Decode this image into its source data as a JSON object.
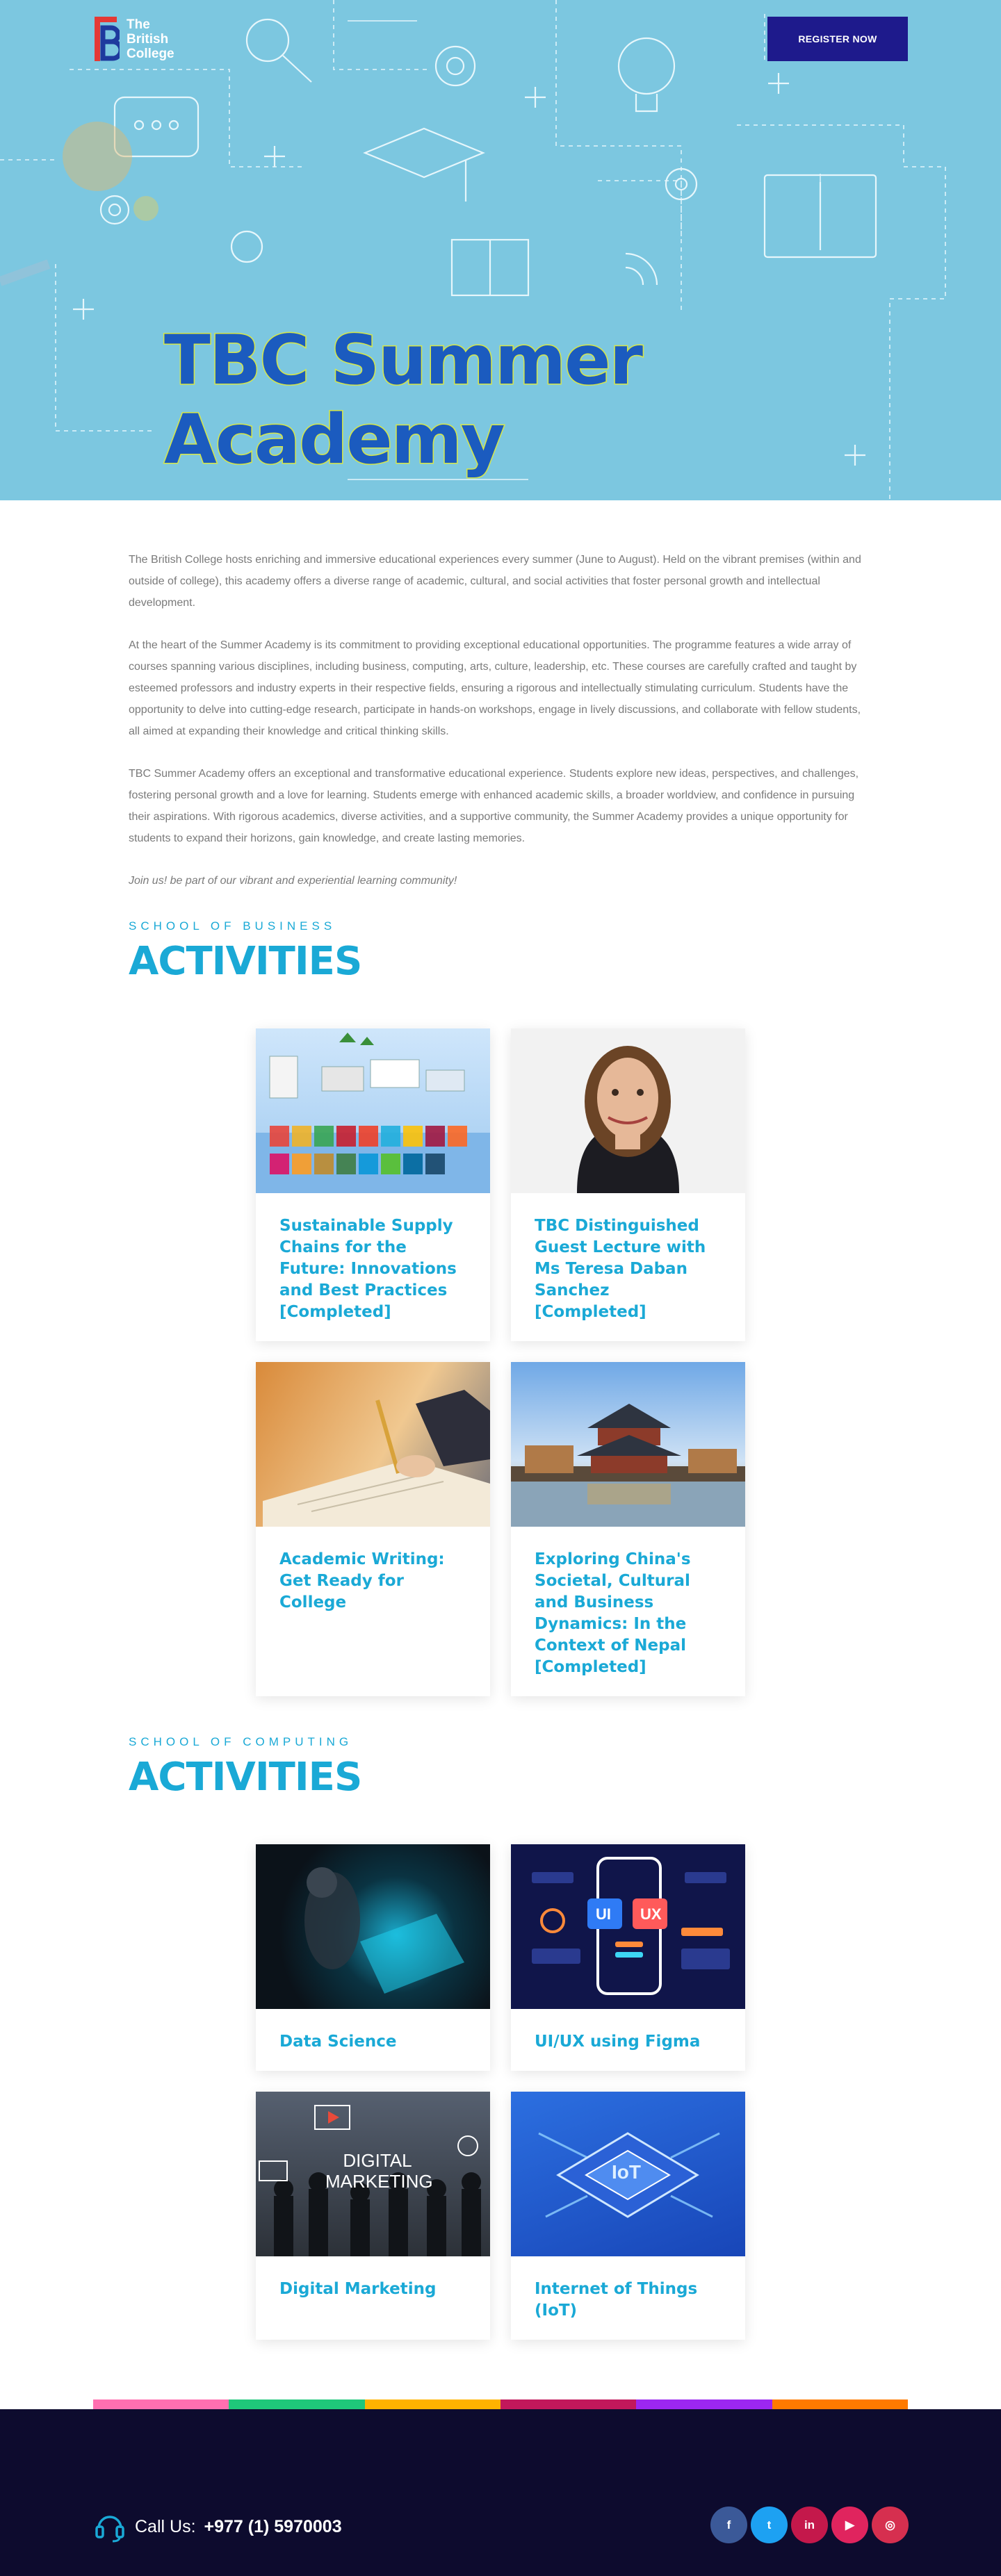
{
  "header": {
    "logo_lines": [
      "The",
      "British",
      "College"
    ],
    "register_label": "REGISTER NOW"
  },
  "hero": {
    "title": "TBC Summer Academy"
  },
  "intro": {
    "paragraphs": [
      "The British College hosts enriching and immersive educational experiences every summer (June to August). Held on the vibrant premises (within and outside of college), this academy offers a diverse range of academic, cultural, and social activities that foster personal growth and intellectual development.",
      "At the heart of the Summer Academy is its commitment to providing exceptional educational opportunities. The programme features a wide array of courses spanning various disciplines, including business, computing, arts, culture, leadership, etc. These courses are carefully crafted and taught by esteemed professors and industry experts in their respective fields, ensuring a rigorous and intellectually stimulating curriculum. Students have the opportunity to delve into cutting-edge research, participate in hands-on workshops, engage in lively discussions, and collaborate with fellow students, all aimed at expanding their knowledge and critical thinking skills.",
      "TBC Summer Academy offers an exceptional and transformative educational experience. Students explore new ideas, perspectives, and challenges, fostering personal growth and a love for learning. Students emerge with enhanced academic skills, a broader worldview, and confidence in pursuing their aspirations. With rigorous academics, diverse activities, and a supportive community, the Summer Academy provides a unique opportunity for students to expand their horizons, gain knowledge, and create lasting memories."
    ],
    "closing": "Join us! be part of our vibrant and experiential learning community!"
  },
  "business": {
    "kicker": "SCHOOL OF BUSINESS",
    "title": "ACTIVITIES",
    "cards": [
      {
        "title": "Sustainable Supply Chains for the Future: Innovations and Best Practices [Completed]",
        "image": "supply-chain-illustration"
      },
      {
        "title": "TBC Distinguished Guest Lecture with Ms Teresa Daban Sanchez [Completed]",
        "image": "speaker-portrait"
      },
      {
        "title": "Academic Writing: Get Ready for College",
        "image": "writing-photo"
      },
      {
        "title": "Exploring China's Societal, Cultural and Business Dynamics: In the Context of Nepal [Completed]",
        "image": "pagoda-photo"
      }
    ]
  },
  "computing": {
    "kicker": "SCHOOL OF COMPUTING",
    "title": "ACTIVITIES",
    "cards": [
      {
        "title": "Data Science",
        "image": "data-science-photo"
      },
      {
        "title": "UI/UX using Figma",
        "image": "uiux-illustration",
        "badges": [
          "UI",
          "UX"
        ]
      },
      {
        "title": "Digital Marketing",
        "image": "digital-marketing-photo",
        "overlay": "DIGITAL MARKETING"
      },
      {
        "title": "Internet of Things (IoT)",
        "image": "iot-chip-illustration",
        "chip_label": "IoT"
      }
    ]
  },
  "footer": {
    "call_label": "Call Us:",
    "phone": "+977 (1) 5970003",
    "color_bar": [
      "#ff6fb0",
      "#1fc77a",
      "#ffb300",
      "#c2185b",
      "#9c27f0",
      "#ff7a00"
    ],
    "socials": [
      {
        "name": "facebook",
        "glyph": "f",
        "color": "#3b5998"
      },
      {
        "name": "twitter",
        "glyph": "t",
        "color": "#1da1f2"
      },
      {
        "name": "linkedin",
        "glyph": "in",
        "color": "#c4184b"
      },
      {
        "name": "youtube",
        "glyph": "▶",
        "color": "#e0245e"
      },
      {
        "name": "instagram",
        "glyph": "◎",
        "color": "#d62f4f"
      }
    ]
  }
}
